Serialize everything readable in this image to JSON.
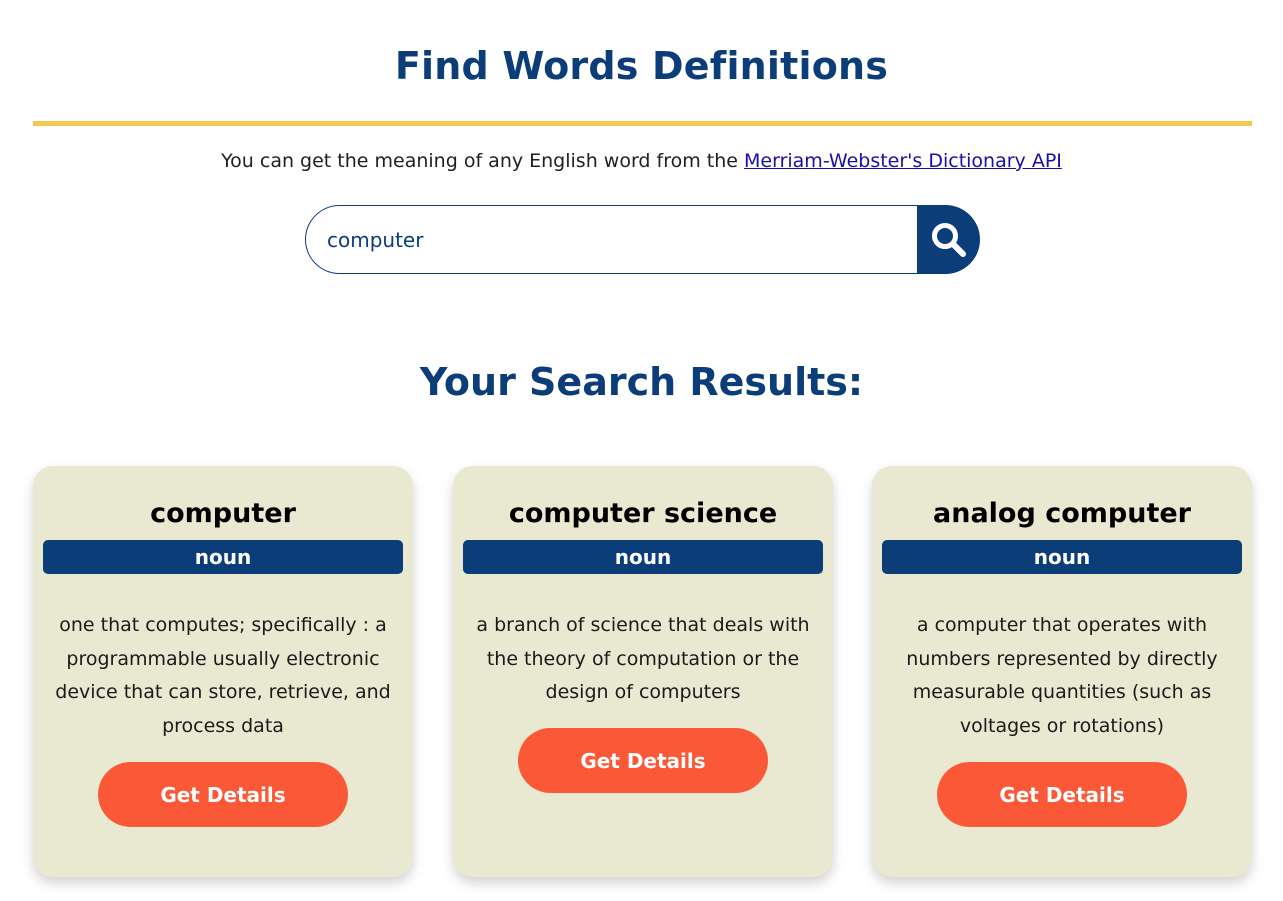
{
  "header": {
    "title": "Find Words Definitions",
    "intro_text": "You can get the meaning of any English word from the ",
    "intro_link": "Merriam-Webster's Dictionary API"
  },
  "search": {
    "value": "computer"
  },
  "results": {
    "heading": "Your Search Results:",
    "cards": [
      {
        "word": "computer",
        "part_of_speech": "noun",
        "definition": "one that computes; specifically : a programmable usually electronic device that can store, retrieve, and process data",
        "button_label": "Get Details"
      },
      {
        "word": "computer science",
        "part_of_speech": "noun",
        "definition": "a branch of science that deals with the theory of computation or the design of computers",
        "button_label": "Get Details"
      },
      {
        "word": "analog computer",
        "part_of_speech": "noun",
        "definition": "a computer that operates with numbers represented by directly measurable quantities (such as voltages or rotations)",
        "button_label": "Get Details"
      }
    ]
  },
  "colors": {
    "primary": "#0b3d78",
    "accent_line": "#f0c94f",
    "card_bg": "#e9e8d1",
    "button": "#fb5838"
  },
  "icons": {
    "search_button_icon": "search-icon"
  }
}
